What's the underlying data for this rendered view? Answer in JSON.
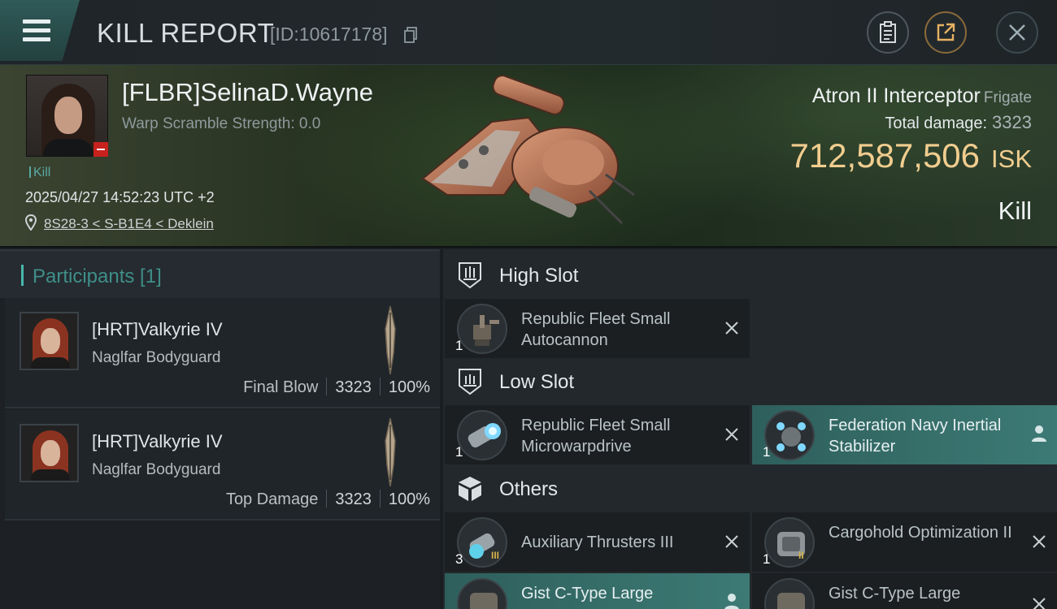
{
  "header": {
    "title": "KILL REPORT",
    "report_id": "[ID:10617178]"
  },
  "victim": {
    "name": "[FLBR]SelinaD.Wayne",
    "warp_scramble": "Warp Scramble Strength: 0.0",
    "kill_tag": "Kill",
    "datetime": "2025/04/27 14:52:23 UTC +2",
    "location": "8S28-3 < S-B1E4 < Deklein",
    "ship_name": "Atron II Interceptor",
    "ship_class": "Frigate",
    "total_damage_label": "Total damage:",
    "total_damage_value": "3323",
    "isk_value": "712,587,506",
    "isk_unit": "ISK",
    "result": "Kill"
  },
  "participants": {
    "header": "Participants [1]",
    "items": [
      {
        "name": "[HRT]Valkyrie IV",
        "ship": "Naglfar Bodyguard",
        "role": "Final Blow",
        "damage": "3323",
        "percent": "100%"
      },
      {
        "name": "[HRT]Valkyrie IV",
        "ship": "Naglfar Bodyguard",
        "role": "Top Damage",
        "damage": "3323",
        "percent": "100%"
      }
    ]
  },
  "slots": {
    "high": {
      "title": "High Slot",
      "items": [
        {
          "name": "Republic Fleet Small Autocannon",
          "qty": "1"
        }
      ]
    },
    "low": {
      "title": "Low Slot",
      "items": [
        {
          "name": "Republic Fleet Small Microwarpdrive",
          "qty": "1"
        },
        {
          "name": "Federation Navy Inertial Stabilizer",
          "qty": "1"
        }
      ]
    },
    "others": {
      "title": "Others",
      "items": [
        {
          "name": "Auxiliary Thrusters III",
          "qty": "3",
          "tier": "III"
        },
        {
          "name": "Cargohold Optimization II",
          "qty": "1",
          "tier": "II"
        },
        {
          "name": "Gist C-Type Large",
          "qty": ""
        },
        {
          "name": "Gist C-Type Large",
          "qty": ""
        }
      ]
    }
  },
  "colors": {
    "accent_teal": "#49b6ac",
    "isk_gold": "#f1cd8f",
    "fitted_module_bg": "#3d7a75",
    "status_red": "#c8221e"
  },
  "icons": [
    "menu-icon",
    "copy-icon",
    "clipboard-icon",
    "share-icon",
    "close-icon",
    "location-pin-icon",
    "high-slot-icon",
    "low-slot-icon",
    "cube-icon",
    "remove-x-icon",
    "person-icon"
  ]
}
